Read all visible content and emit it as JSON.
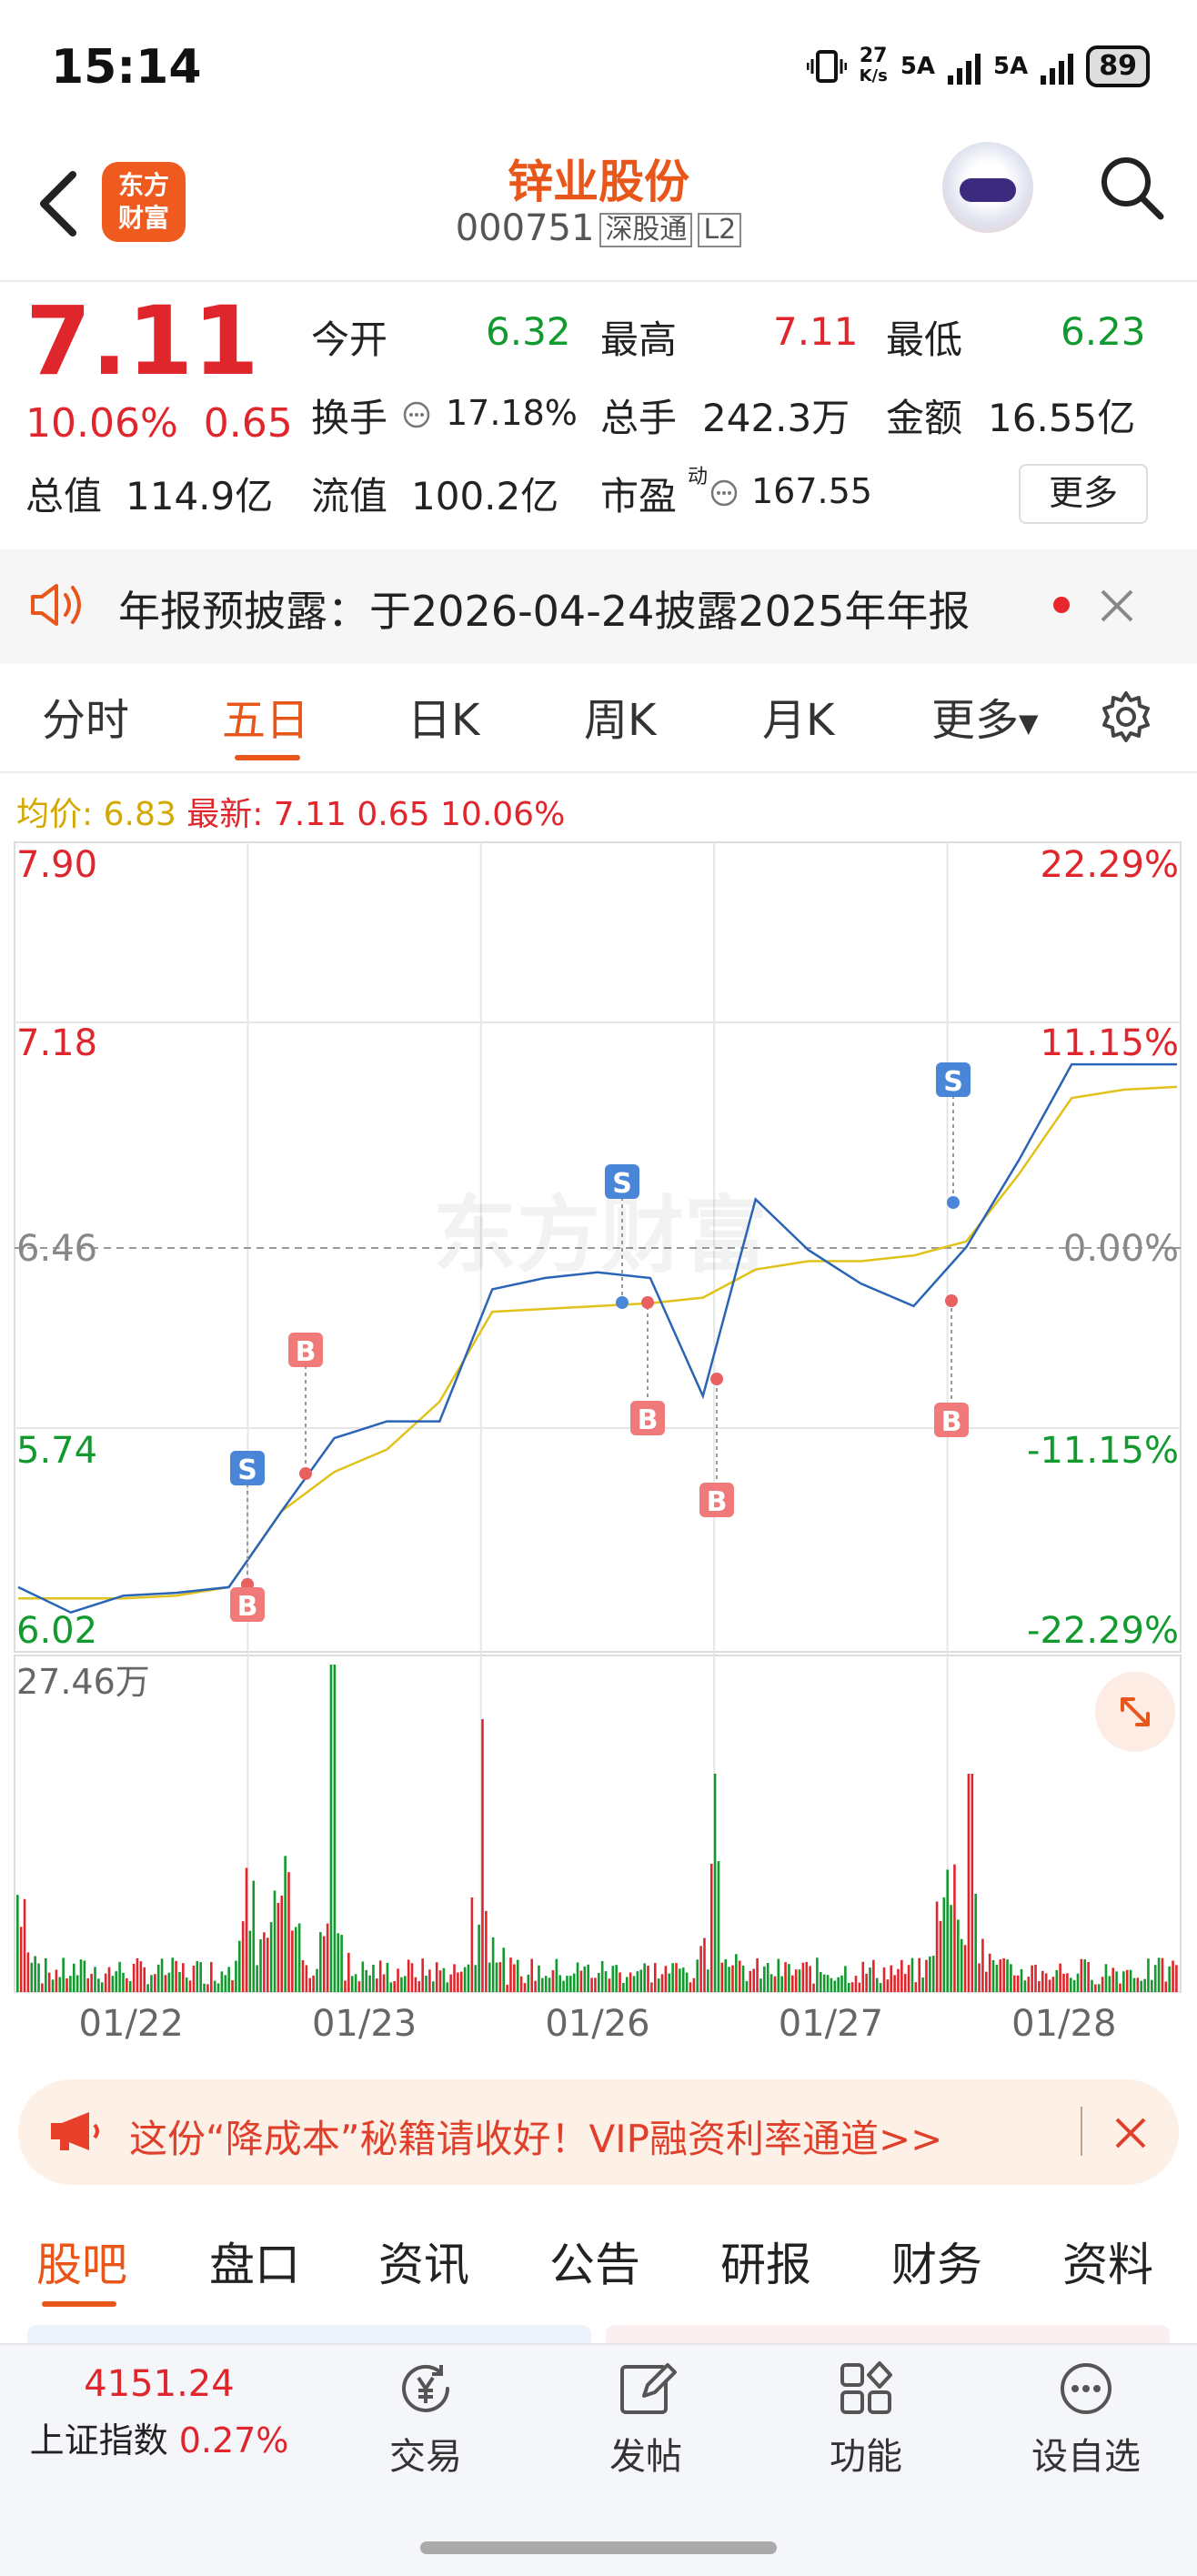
{
  "status_bar": {
    "time": "15:14",
    "net_speed_value": "27",
    "net_speed_unit": "K/s",
    "sim1": "5A",
    "sim2": "5A",
    "battery": "89"
  },
  "header": {
    "stock_name": "锌业股份",
    "stock_code": "000751",
    "tag_connect": "深股通",
    "tag_level": "L2",
    "brand_line1": "东方",
    "brand_line2": "财富"
  },
  "quote": {
    "price": "7.11",
    "change_pct": "10.06%",
    "change_amt": "0.65",
    "open_label": "今开",
    "open": "6.32",
    "high_label": "最高",
    "high": "7.11",
    "low_label": "最低",
    "low": "6.23",
    "turnover_label": "换手",
    "turnover": "17.18%",
    "volume_label": "总手",
    "volume": "242.3万",
    "amount_label": "金额",
    "amount": "16.55亿",
    "mktcap_label": "总值",
    "mktcap": "114.9亿",
    "float_label": "流值",
    "float": "100.2亿",
    "pe_label": "市盈",
    "pe_sup": "动",
    "pe": "167.55",
    "more": "更多"
  },
  "notice": {
    "text": "年报预披露：于2026-04-24披露2025年年报"
  },
  "chart_tabs": [
    "分时",
    "五日",
    "日K",
    "周K",
    "月K",
    "更多"
  ],
  "chart_tab_active": "五日",
  "legend": {
    "avg_label": "均价:",
    "avg": "6.83",
    "latest_label": "最新:",
    "latest": "7.11",
    "latest_chg": "0.65",
    "latest_pct": "10.06%"
  },
  "watermark": "东方财富",
  "chart_data": {
    "type": "line",
    "title": "",
    "x_labels": [
      "01/22",
      "01/23",
      "01/26",
      "01/27",
      "01/28"
    ],
    "y_left_ticks": [
      "7.90",
      "7.18",
      "6.46",
      "5.74",
      "6.02"
    ],
    "y_right_ticks": [
      "22.29%",
      "11.15%",
      "0.00%",
      "-11.15%",
      "-22.29%"
    ],
    "ylim": [
      5.02,
      7.9
    ],
    "prev_close": 6.46,
    "volume_max_label": "27.46万",
    "series": [
      {
        "name": "均价",
        "values": [
          5.21,
          5.21,
          5.21,
          5.22,
          5.25,
          5.52,
          5.66,
          5.74,
          5.91,
          6.23,
          6.24,
          6.25,
          6.26,
          6.28,
          6.38,
          6.41,
          6.41,
          6.43,
          6.48,
          6.72,
          6.99,
          7.02,
          7.03
        ]
      },
      {
        "name": "最新",
        "values": [
          5.25,
          5.16,
          5.22,
          5.23,
          5.25,
          5.52,
          5.78,
          5.84,
          5.84,
          6.31,
          6.35,
          6.37,
          6.35,
          5.93,
          6.63,
          6.45,
          6.33,
          6.25,
          6.46,
          6.77,
          7.11,
          7.11,
          7.11
        ]
      }
    ],
    "trade_markers": [
      {
        "type": "S",
        "x_label": "01/22"
      },
      {
        "type": "B",
        "x_label": "01/22"
      },
      {
        "type": "B",
        "x_label": "01/23"
      },
      {
        "type": "S",
        "x_label": "01/26"
      },
      {
        "type": "B",
        "x_label": "01/26"
      },
      {
        "type": "B",
        "x_label": "01/27"
      },
      {
        "type": "S",
        "x_label": "01/27"
      },
      {
        "type": "B",
        "x_label": "01/27"
      }
    ]
  },
  "promo": {
    "text": "这份“降成本”秘籍请收好！VIP融资利率通道>>"
  },
  "bottom_tabs": [
    "股吧",
    "盘口",
    "资讯",
    "公告",
    "研报",
    "财务",
    "资料"
  ],
  "bottom_tab_active": "股吧",
  "bottom_nav": {
    "index_value": "4151.24",
    "index_name": "上证指数",
    "index_pct": "0.27%",
    "items": [
      "交易",
      "发帖",
      "功能",
      "设自选"
    ]
  }
}
